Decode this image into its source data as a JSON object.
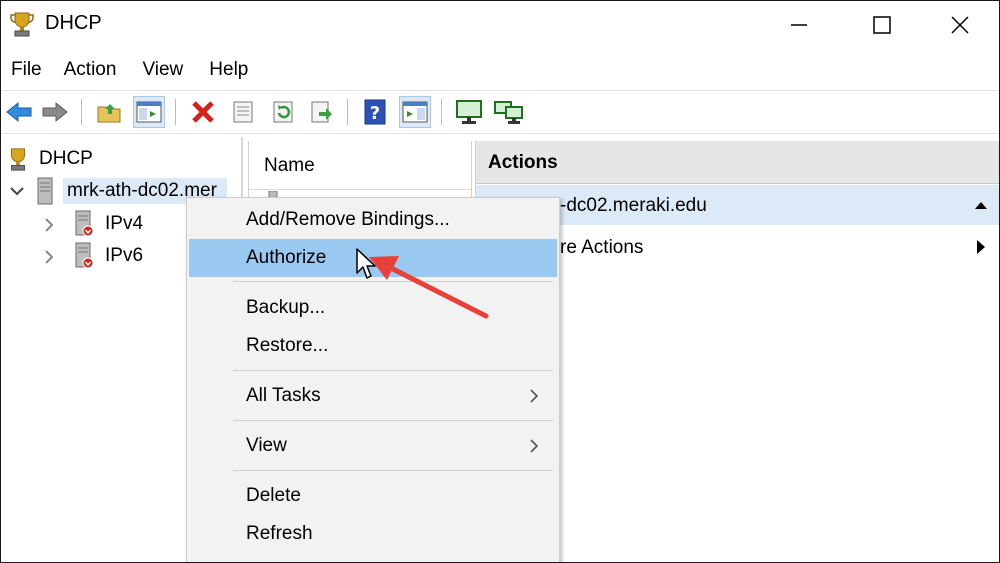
{
  "window": {
    "title": "DHCP"
  },
  "menu": [
    "File",
    "Action",
    "View",
    "Help"
  ],
  "tree": {
    "root": "DHCP",
    "server": "mrk-ath-dc02.mer",
    "children": [
      "IPv4",
      "IPv6"
    ]
  },
  "center": {
    "column_header": "Name"
  },
  "actions": {
    "header": "Actions",
    "selected_item": "-dc02.meraki.edu",
    "more": "re Actions"
  },
  "context_menu": {
    "items": [
      {
        "label": "Add/Remove Bindings..."
      },
      {
        "label": "Authorize"
      },
      {
        "label": "Backup..."
      },
      {
        "label": "Restore..."
      },
      {
        "label": "All Tasks"
      },
      {
        "label": "View"
      },
      {
        "label": "Delete"
      },
      {
        "label": "Refresh"
      }
    ]
  },
  "colors": {
    "highlight": "#99c8f1",
    "selection": "#dce9f7",
    "annotation": "#e8413a"
  }
}
